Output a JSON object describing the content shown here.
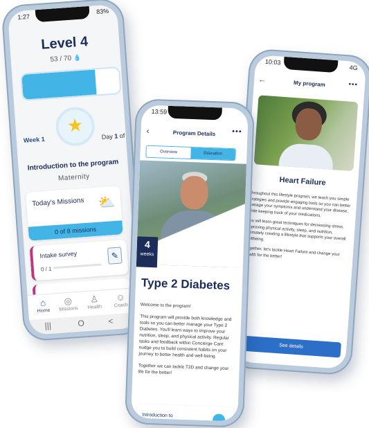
{
  "phone_level": {
    "status_time": "1:27",
    "status_right": "83%",
    "level_title": "Level 4",
    "level_count": "53 / 70",
    "progress_fraction": 0.757,
    "week_label": "Week 1",
    "day_prefix": "Day ",
    "day_num": "1",
    "day_suffix": " of 7",
    "intro_title": "Introduction to the program",
    "intro_subtitle": "Maternity",
    "missions_title": "Today's Missions",
    "missions_progress": "0 of 8 missions",
    "survey_title": "Intake survey",
    "survey_count": "0 / 1",
    "tabs": [
      {
        "label": "Home",
        "icon": "home-icon"
      },
      {
        "label": "Missions",
        "icon": "missions-icon"
      },
      {
        "label": "Health",
        "icon": "health-icon"
      },
      {
        "label": "Coach",
        "icon": "coach-icon"
      }
    ],
    "nav": [
      "|||",
      "O",
      "<"
    ]
  },
  "phone_program": {
    "status_time": "13:59",
    "title": "Program Details",
    "tabs": [
      "Overview",
      "Education"
    ],
    "weeks_num": "4",
    "weeks_label": "weeks",
    "program_title": "Type 2 Diabetes",
    "paragraphs": [
      "Welcome to the program!",
      "This program will provide both knowledge and tools so you can better manage your Type 2 Diabetes. You'll learn ways to improve your nutrition, sleep, and physical activity. Regular tasks and feedback within Concierge Care nudge you to build consistent habits on your journey to better health and well-being.",
      "Together we can tackle T2D and change your life for the better!"
    ],
    "intro_card": "Introduction to"
  },
  "phone_myprogram": {
    "status_time": "10:03",
    "status_right": "4G",
    "title": "My program",
    "program_title": "Heart Failure",
    "paragraphs": [
      "Throughout this lifestyle program, we teach you simple strategies and provide engaging tools so you can better manage your symptoms and understand your disease, while keeping track of your medications.",
      "You will learn great techniques for decreasing stress, improving physical activity, sleep, and nutrition, ultimately creating a lifestyle that supports your overall wellbeing.",
      "Together, let's tackle Heart Failure and change your health for the better!"
    ],
    "button_label": "See details"
  },
  "colors": {
    "accent": "#43b4e6",
    "navy": "#1c2d5a",
    "magenta": "#c0357a",
    "button_blue": "#2c6fc8"
  }
}
